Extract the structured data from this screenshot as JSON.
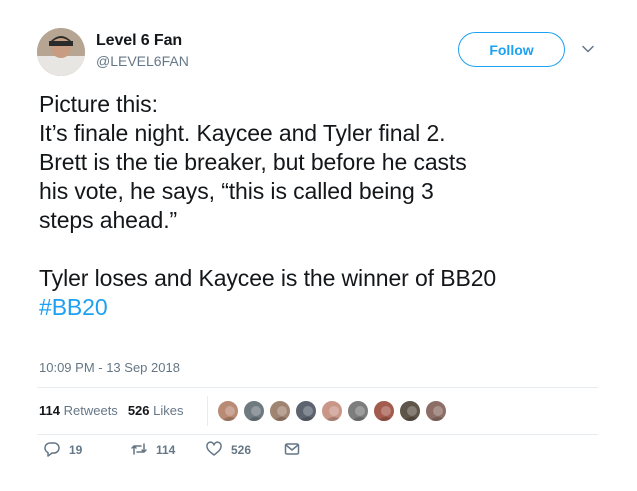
{
  "user": {
    "display_name": "Level 6 Fan",
    "handle": "@LEVEL6FAN"
  },
  "follow_label": "Follow",
  "tweet": {
    "lines_a": [
      "Picture this:",
      "It’s finale night. Kaycee and Tyler final 2.",
      "Brett is the tie breaker, but before he casts",
      "his vote, he says, “this is called being 3",
      "steps ahead.”"
    ],
    "lines_b": [
      "Tyler loses and Kaycee is the winner of BB20"
    ],
    "hashtag": "#BB20"
  },
  "timestamp": "10:09 PM - 13 Sep 2018",
  "stats": {
    "retweets_count": "114",
    "retweets_label": "Retweets",
    "likes_count": "526",
    "likes_label": "Likes"
  },
  "liker_avatar_colors": [
    "#b98a74",
    "#6f7a80",
    "#a08472",
    "#5d6470",
    "#c99688",
    "#7d7d7d",
    "#a35b4e",
    "#5f5548",
    "#8d6e66"
  ],
  "actions": {
    "reply_count": "19",
    "retweet_count": "114",
    "like_count": "526"
  },
  "colors": {
    "accent": "#1da1f2",
    "text": "#14171a",
    "muted": "#657786"
  }
}
